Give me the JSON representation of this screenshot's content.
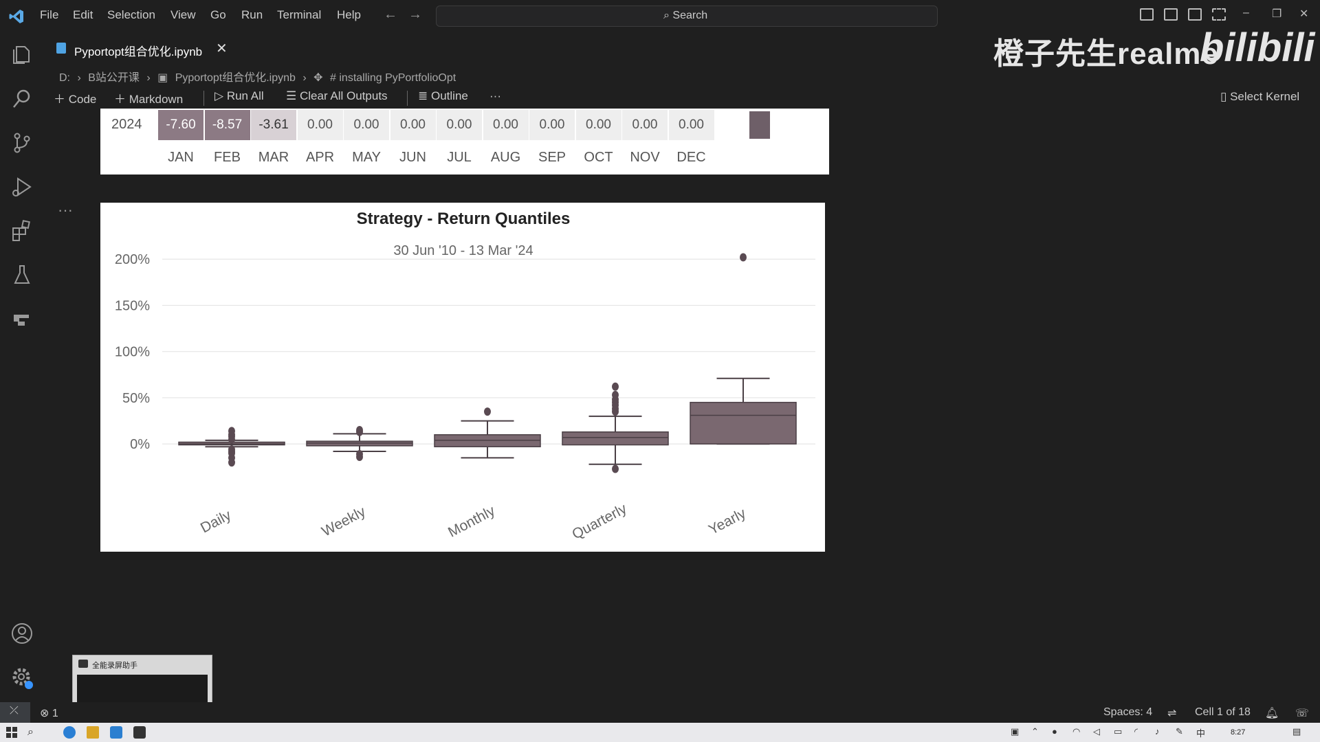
{
  "menu": [
    "File",
    "Edit",
    "Selection",
    "View",
    "Go",
    "Run",
    "Terminal",
    "Help"
  ],
  "search": {
    "label": "Search"
  },
  "watermark": {
    "text": "橙子先生realme",
    "brand": "bilibili"
  },
  "tab": {
    "filename": "Pyportopt组合优化.ipynb"
  },
  "breadcrumb": {
    "drive": "D:",
    "folder": "B站公开课",
    "file": "Pyportopt组合优化.ipynb",
    "section": "# installing PyPortfolioOpt"
  },
  "toolbar": {
    "code": "Code",
    "markdown": "Markdown",
    "run_all": "Run All",
    "clear_all": "Clear All Outputs",
    "outline": "Outline",
    "more": "···"
  },
  "kernel": {
    "label": "Select Kernel"
  },
  "heatmap": {
    "year": "2024",
    "months": [
      "JAN",
      "FEB",
      "MAR",
      "APR",
      "MAY",
      "JUN",
      "JUL",
      "AUG",
      "SEP",
      "OCT",
      "NOV",
      "DEC"
    ],
    "values": [
      "-7.60",
      "-8.57",
      "-3.61",
      "0.00",
      "0.00",
      "0.00",
      "0.00",
      "0.00",
      "0.00",
      "0.00",
      "0.00",
      "0.00"
    ]
  },
  "chart_data": {
    "type": "box",
    "title": "Strategy - Return Quantiles",
    "subtitle": "30 Jun '10 - 13 Mar '24",
    "yticks": [
      "200%",
      "150%",
      "100%",
      "50%",
      "0%"
    ],
    "ylim": [
      -40,
      215
    ],
    "categories": [
      "Daily",
      "Weekly",
      "Monthly",
      "Quarterly",
      "Yearly"
    ],
    "series": [
      {
        "category": "Daily",
        "min": -3,
        "q1": -1,
        "median": 0,
        "q3": 2,
        "max": 4,
        "outliers": [
          -20,
          -15,
          -10,
          -8,
          -6,
          5,
          8,
          10,
          14
        ]
      },
      {
        "category": "Weekly",
        "min": -8,
        "q1": -2,
        "median": 1,
        "q3": 3,
        "max": 11,
        "outliers": [
          -14,
          -11,
          13,
          15
        ]
      },
      {
        "category": "Monthly",
        "min": -15,
        "q1": -3,
        "median": 4,
        "q3": 10,
        "max": 25,
        "outliers": [
          35
        ]
      },
      {
        "category": "Quarterly",
        "min": -22,
        "q1": -1,
        "median": 7,
        "q3": 13,
        "max": 30,
        "outliers": [
          -27,
          35,
          38,
          42,
          45,
          48,
          53,
          62
        ]
      },
      {
        "category": "Yearly",
        "min": 0,
        "q1": 0,
        "median": 31,
        "q3": 45,
        "max": 71,
        "outliers": [
          202
        ]
      }
    ],
    "color": "#7a6870",
    "grid": true
  },
  "popup": {
    "title": "全能录屏助手"
  },
  "status": {
    "errors": "1",
    "spaces": "Spaces: 4",
    "cell": "Cell 1 of 18"
  },
  "taskbar": {
    "time": "8:27"
  }
}
